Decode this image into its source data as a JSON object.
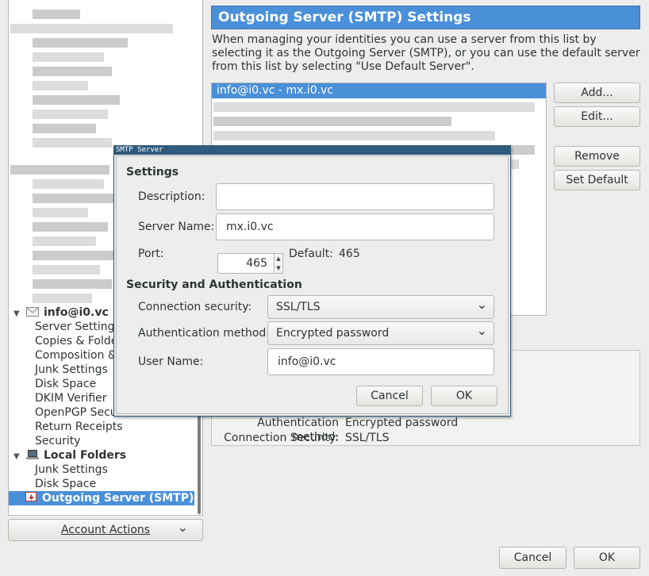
{
  "tree": {
    "account_name": "info@i0.vc",
    "account_children": [
      "Server Settings",
      "Copies & Folde",
      "Composition &",
      "Junk Settings",
      "Disk Space",
      "DKIM Verifier",
      "OpenPGP Secur",
      "Return Receipts",
      "Security"
    ],
    "local_folders_label": "Local Folders",
    "local_children": [
      "Junk Settings",
      "Disk Space"
    ],
    "outgoing_label": "Outgoing Server (SMTP)",
    "twisty_glyph": "▼"
  },
  "account_actions": {
    "label": "Account Actions",
    "chevron": "⌄"
  },
  "pane": {
    "title": "Outgoing Server (SMTP) Settings",
    "description": "When managing your identities you can use a server from this list by selecting it as the Outgoing Server (SMTP), or you can use the default server from this list by selecting \"Use Default Server\".",
    "selected_server": "info@i0.vc - mx.i0.vc",
    "buttons": {
      "add": "Add...",
      "edit": "Edit...",
      "remove": "Remove",
      "set_default": "Set Default"
    },
    "details": {
      "auth_label": "Authentication method:",
      "auth_value": "Encrypted password",
      "conn_label": "Connection Security:",
      "conn_value": "SSL/TLS"
    }
  },
  "dialog": {
    "title": "SMTP Server",
    "settings_heading": "Settings",
    "description_label": "Description:",
    "description_value": "",
    "server_name_label": "Server Name:",
    "server_name_value": "mx.i0.vc",
    "port_label": "Port:",
    "port_value": "465",
    "default_label": "Default:",
    "default_value": "465",
    "security_heading": "Security and Authentication",
    "connection_security_label": "Connection security:",
    "connection_security_value": "SSL/TLS",
    "auth_method_label": "Authentication method:",
    "auth_method_value": "Encrypted password",
    "user_name_label": "User Name:",
    "user_name_value": "info@i0.vc",
    "cancel": "Cancel",
    "ok": "OK",
    "spin_up": "▲",
    "spin_down": "▼",
    "chevron": "⌄"
  },
  "footer": {
    "cancel": "Cancel",
    "ok": "OK"
  },
  "colors": {
    "accent": "#4a90d9",
    "dialog_frame": "#2f5b7d"
  }
}
